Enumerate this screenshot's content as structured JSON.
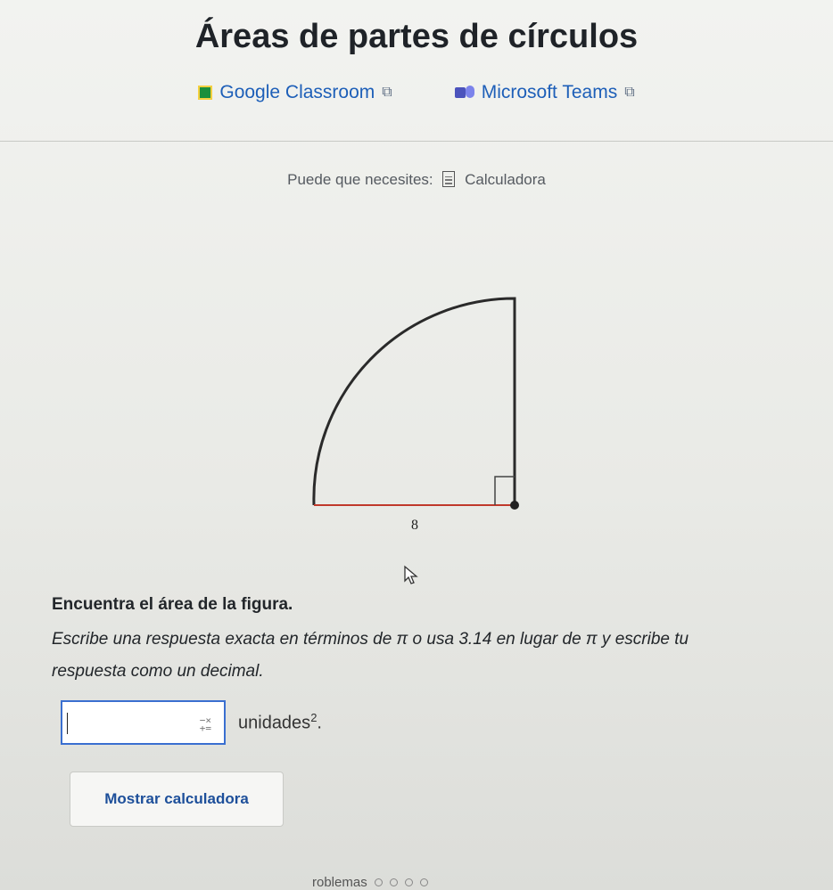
{
  "page": {
    "title": "Áreas de partes de círculos"
  },
  "share": {
    "google_classroom": "Google Classroom",
    "microsoft_teams": "Microsoft Teams"
  },
  "needs": {
    "label": "Puede que necesites:",
    "tool": "Calculadora"
  },
  "figure": {
    "radius_label": "8",
    "shape": "quarter-circle"
  },
  "question": {
    "prompt": "Encuentra el área de la figura.",
    "instructions": "Escribe una respuesta exacta en términos de π o usa 3.14 en lugar de π y escribe tu respuesta como un decimal."
  },
  "answer": {
    "value": "",
    "units": "unidades",
    "units_exponent": "2",
    "units_suffix": "."
  },
  "buttons": {
    "show_calculator": "Mostrar calculadora"
  },
  "footer": {
    "partial_text": "roblemas"
  },
  "colors": {
    "link": "#1d5fb8",
    "radius_line": "#c0392b",
    "input_border": "#3a6fd0"
  }
}
